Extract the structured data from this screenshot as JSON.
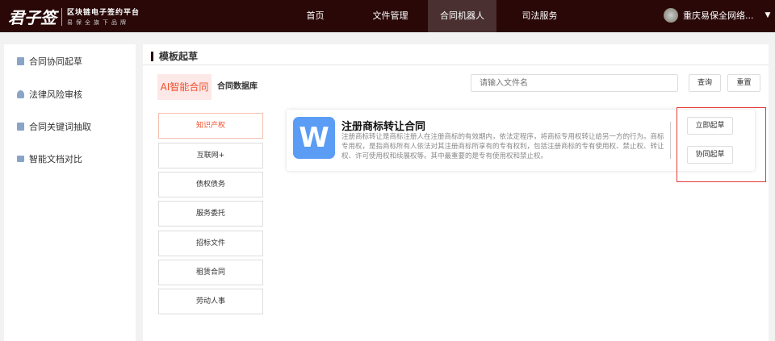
{
  "header": {
    "logo_main": "君子签",
    "logo_line1": "区块链电子签约平台",
    "logo_line2": "易保全旗下品牌",
    "nav": [
      "首页",
      "文件管理",
      "合同机器人",
      "司法服务"
    ],
    "active_nav": 2,
    "user": "重庆易保全网络...",
    "colors": {
      "header_bg": "#2a0808",
      "accent": "#f0502c"
    }
  },
  "sidebar": {
    "items": [
      "合同协同起草",
      "法律风险审核",
      "合同关键词抽取",
      "智能文档对比"
    ]
  },
  "main": {
    "title": "模板起草",
    "tabs": [
      "AI智能合同",
      "合同数据库"
    ],
    "search_placeholder": "请输入文件名",
    "query": "查询",
    "reset": "重置",
    "categories": [
      "知识产权",
      "互联网+",
      "债权债务",
      "服务委托",
      "招标文件",
      "租赁合同",
      "劳动人事"
    ],
    "card": {
      "icon": "W",
      "title": "注册商标转让合同",
      "desc": "注册商标转让是商标注册人在注册商标的有效期内，依法定程序，将商标专用权转让给另一方的行为。商标专用权，是指商标所有人依法对其注册商标所享有的专有权利，包括注册商标的专有使用权、禁止权、转让权、许可使用权和续展权等。其中最重要的是专有使用权和禁止权。",
      "draft": "立即起草",
      "collab": "协同起草"
    }
  }
}
